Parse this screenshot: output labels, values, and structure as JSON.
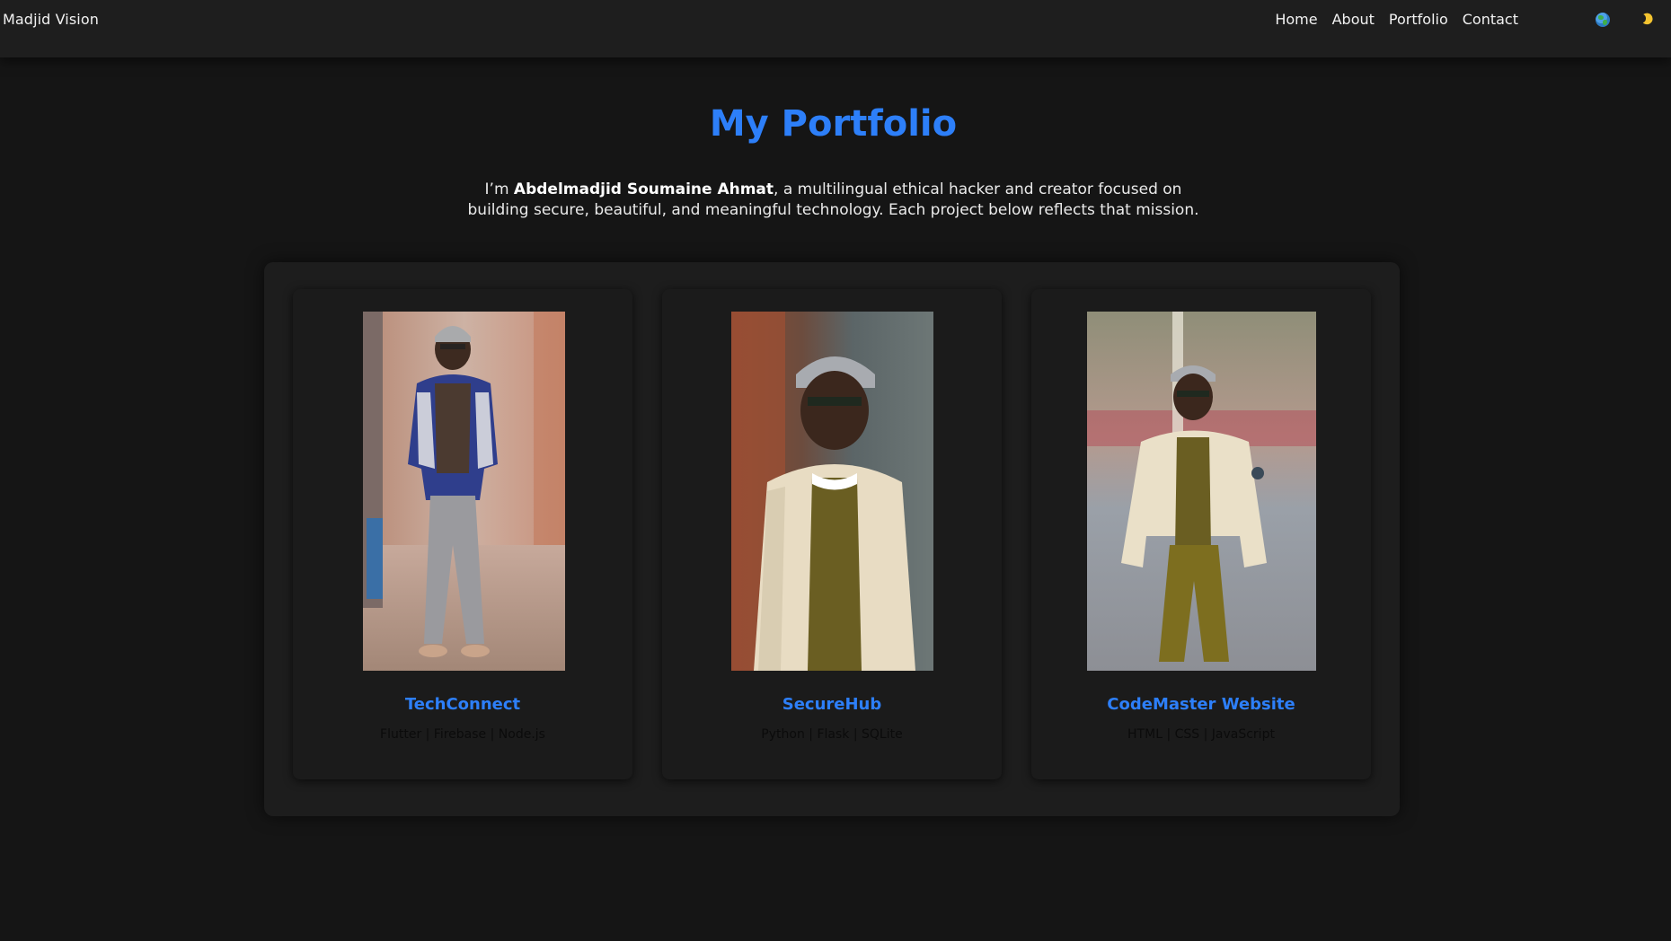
{
  "navbar": {
    "brand": "Madjid Vision",
    "links": [
      "Home",
      "About",
      "Portfolio",
      "Contact"
    ],
    "language_icon": "globe-icon",
    "theme_icon": "moon-icon"
  },
  "hero": {
    "title": "My Portfolio",
    "intro_prefix": "I’m ",
    "intro_name": "Abdelmadjid Soumaine Ahmat",
    "intro_suffix": ", a multilingual ethical hacker and creator focused on building secure, beautiful, and meaningful technology. Each project below reflects that mission."
  },
  "projects": [
    {
      "title": "TechConnect",
      "tech": "Flutter | Firebase | Node.js",
      "image": "photo-portrait-blue-jacket"
    },
    {
      "title": "SecureHub",
      "tech": "Python | Flask | SQLite",
      "image": "photo-portrait-cream-jacket-closeup"
    },
    {
      "title": "CodeMaster Website",
      "tech": "HTML | CSS | JavaScript",
      "image": "photo-portrait-cream-jacket-fullbody"
    }
  ],
  "colors": {
    "accent": "#2d7ff9",
    "background": "#151515",
    "navbar": "#1e1e1e",
    "card": "#1b1b1b"
  }
}
